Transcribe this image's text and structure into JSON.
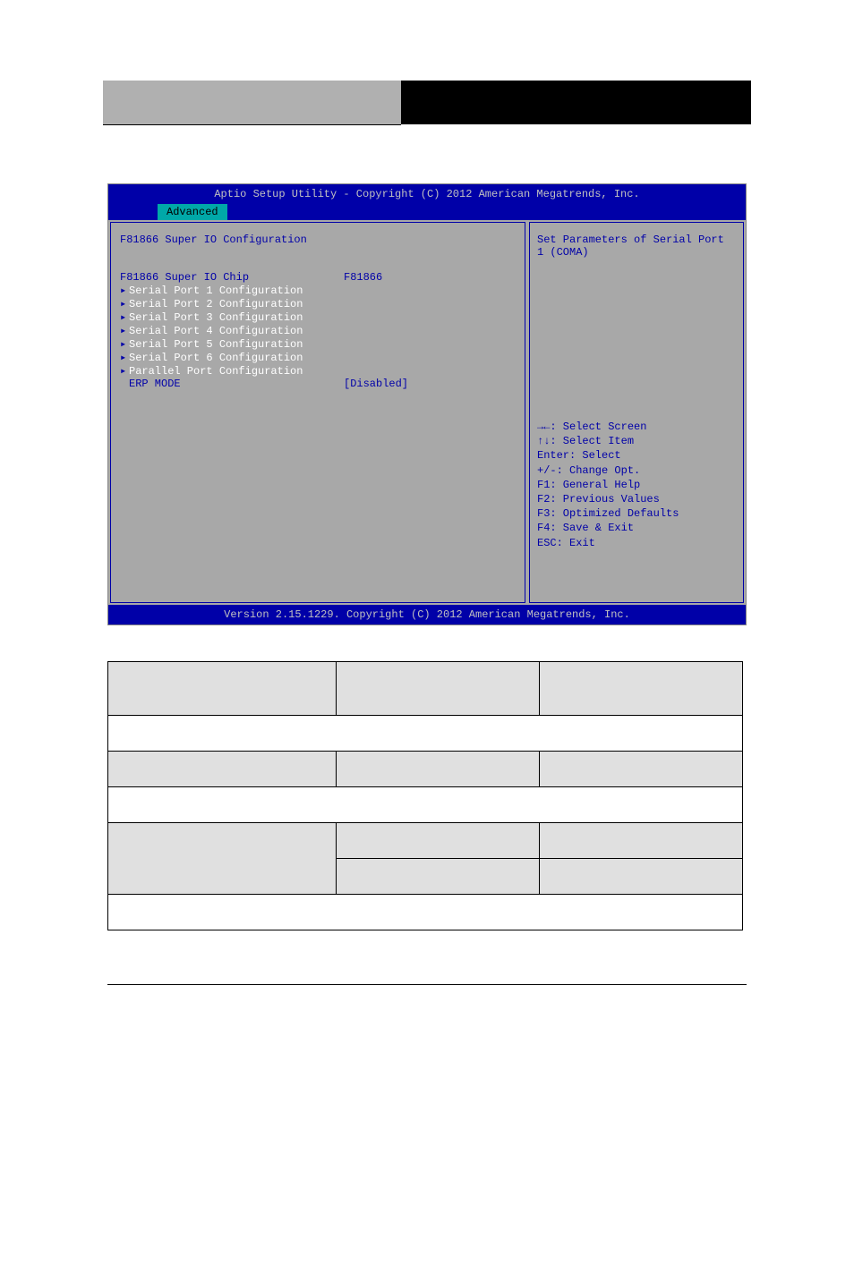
{
  "bios": {
    "title_bar": "Aptio Setup Utility - Copyright (C) 2012 American Megatrends, Inc.",
    "tab": "Advanced",
    "section_title": "F81866 Super IO Configuration",
    "chip_label": "F81866 Super IO Chip",
    "chip_value": "F81866",
    "submenus": [
      "Serial Port 1 Configuration",
      "Serial Port 2 Configuration",
      "Serial Port 3 Configuration",
      "Serial Port 4 Configuration",
      "Serial Port 5 Configuration",
      "Serial Port 6 Configuration",
      "Parallel Port Configuration"
    ],
    "erp_label": "ERP MODE",
    "erp_value": "[Disabled]",
    "help_text": "Set Parameters of Serial Port 1 (COMA)",
    "keys": {
      "k1": "→←: Select Screen",
      "k2": "↑↓: Select Item",
      "k3": "Enter: Select",
      "k4": "+/-: Change Opt.",
      "k5": "F1: General Help",
      "k6": "F2: Previous Values",
      "k7": "F3: Optimized Defaults",
      "k8": "F4: Save & Exit",
      "k9": "ESC: Exit"
    },
    "bottom_bar": "Version 2.15.1229. Copyright (C) 2012 American Megatrends, Inc."
  },
  "table": {
    "r1c1": "",
    "r1c2": "",
    "r1c3": "",
    "r2": "",
    "r3c1": "",
    "r3c2": "",
    "r3c3": "",
    "r4": "",
    "r5c1": "",
    "r5c2": "",
    "r5c3": "",
    "r6c2": "",
    "r6c3": "",
    "r7": ""
  }
}
